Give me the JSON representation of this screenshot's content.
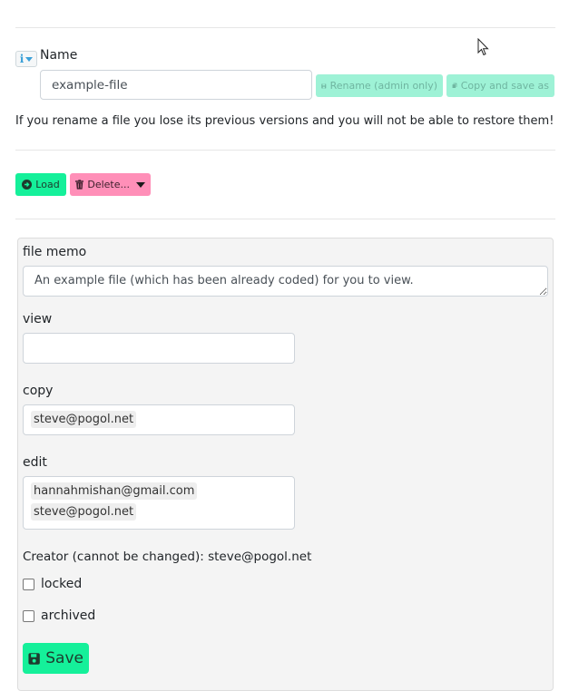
{
  "name_section": {
    "label": "Name",
    "info_icon_text": "i",
    "input_value": "example-file",
    "rename_label": "Rename (admin only)",
    "copy_label": "Copy and save as",
    "warning": "If you rename a file you lose its previous versions and you will not be able to restore them!"
  },
  "actions": {
    "load_label": "Load",
    "delete_label": "Delete..."
  },
  "form": {
    "memo_label": "file memo",
    "memo_value": "An example file (which has been already coded) for you to view.",
    "view_label": "view",
    "view_tags": [],
    "copy_label": "copy",
    "copy_tags": [
      "steve@pogol.net"
    ],
    "edit_label": "edit",
    "edit_tags": [
      "hannahmishan@gmail.com",
      "steve@pogol.net"
    ],
    "creator_text": "Creator (cannot be changed): steve@pogol.net",
    "locked_label": "locked",
    "locked_checked": false,
    "archived_label": "archived",
    "archived_checked": false,
    "save_label": "Save"
  },
  "colors": {
    "primary": "#15f09a",
    "danger": "#ff8fb8",
    "disabled_primary": "#9ef2d6"
  }
}
